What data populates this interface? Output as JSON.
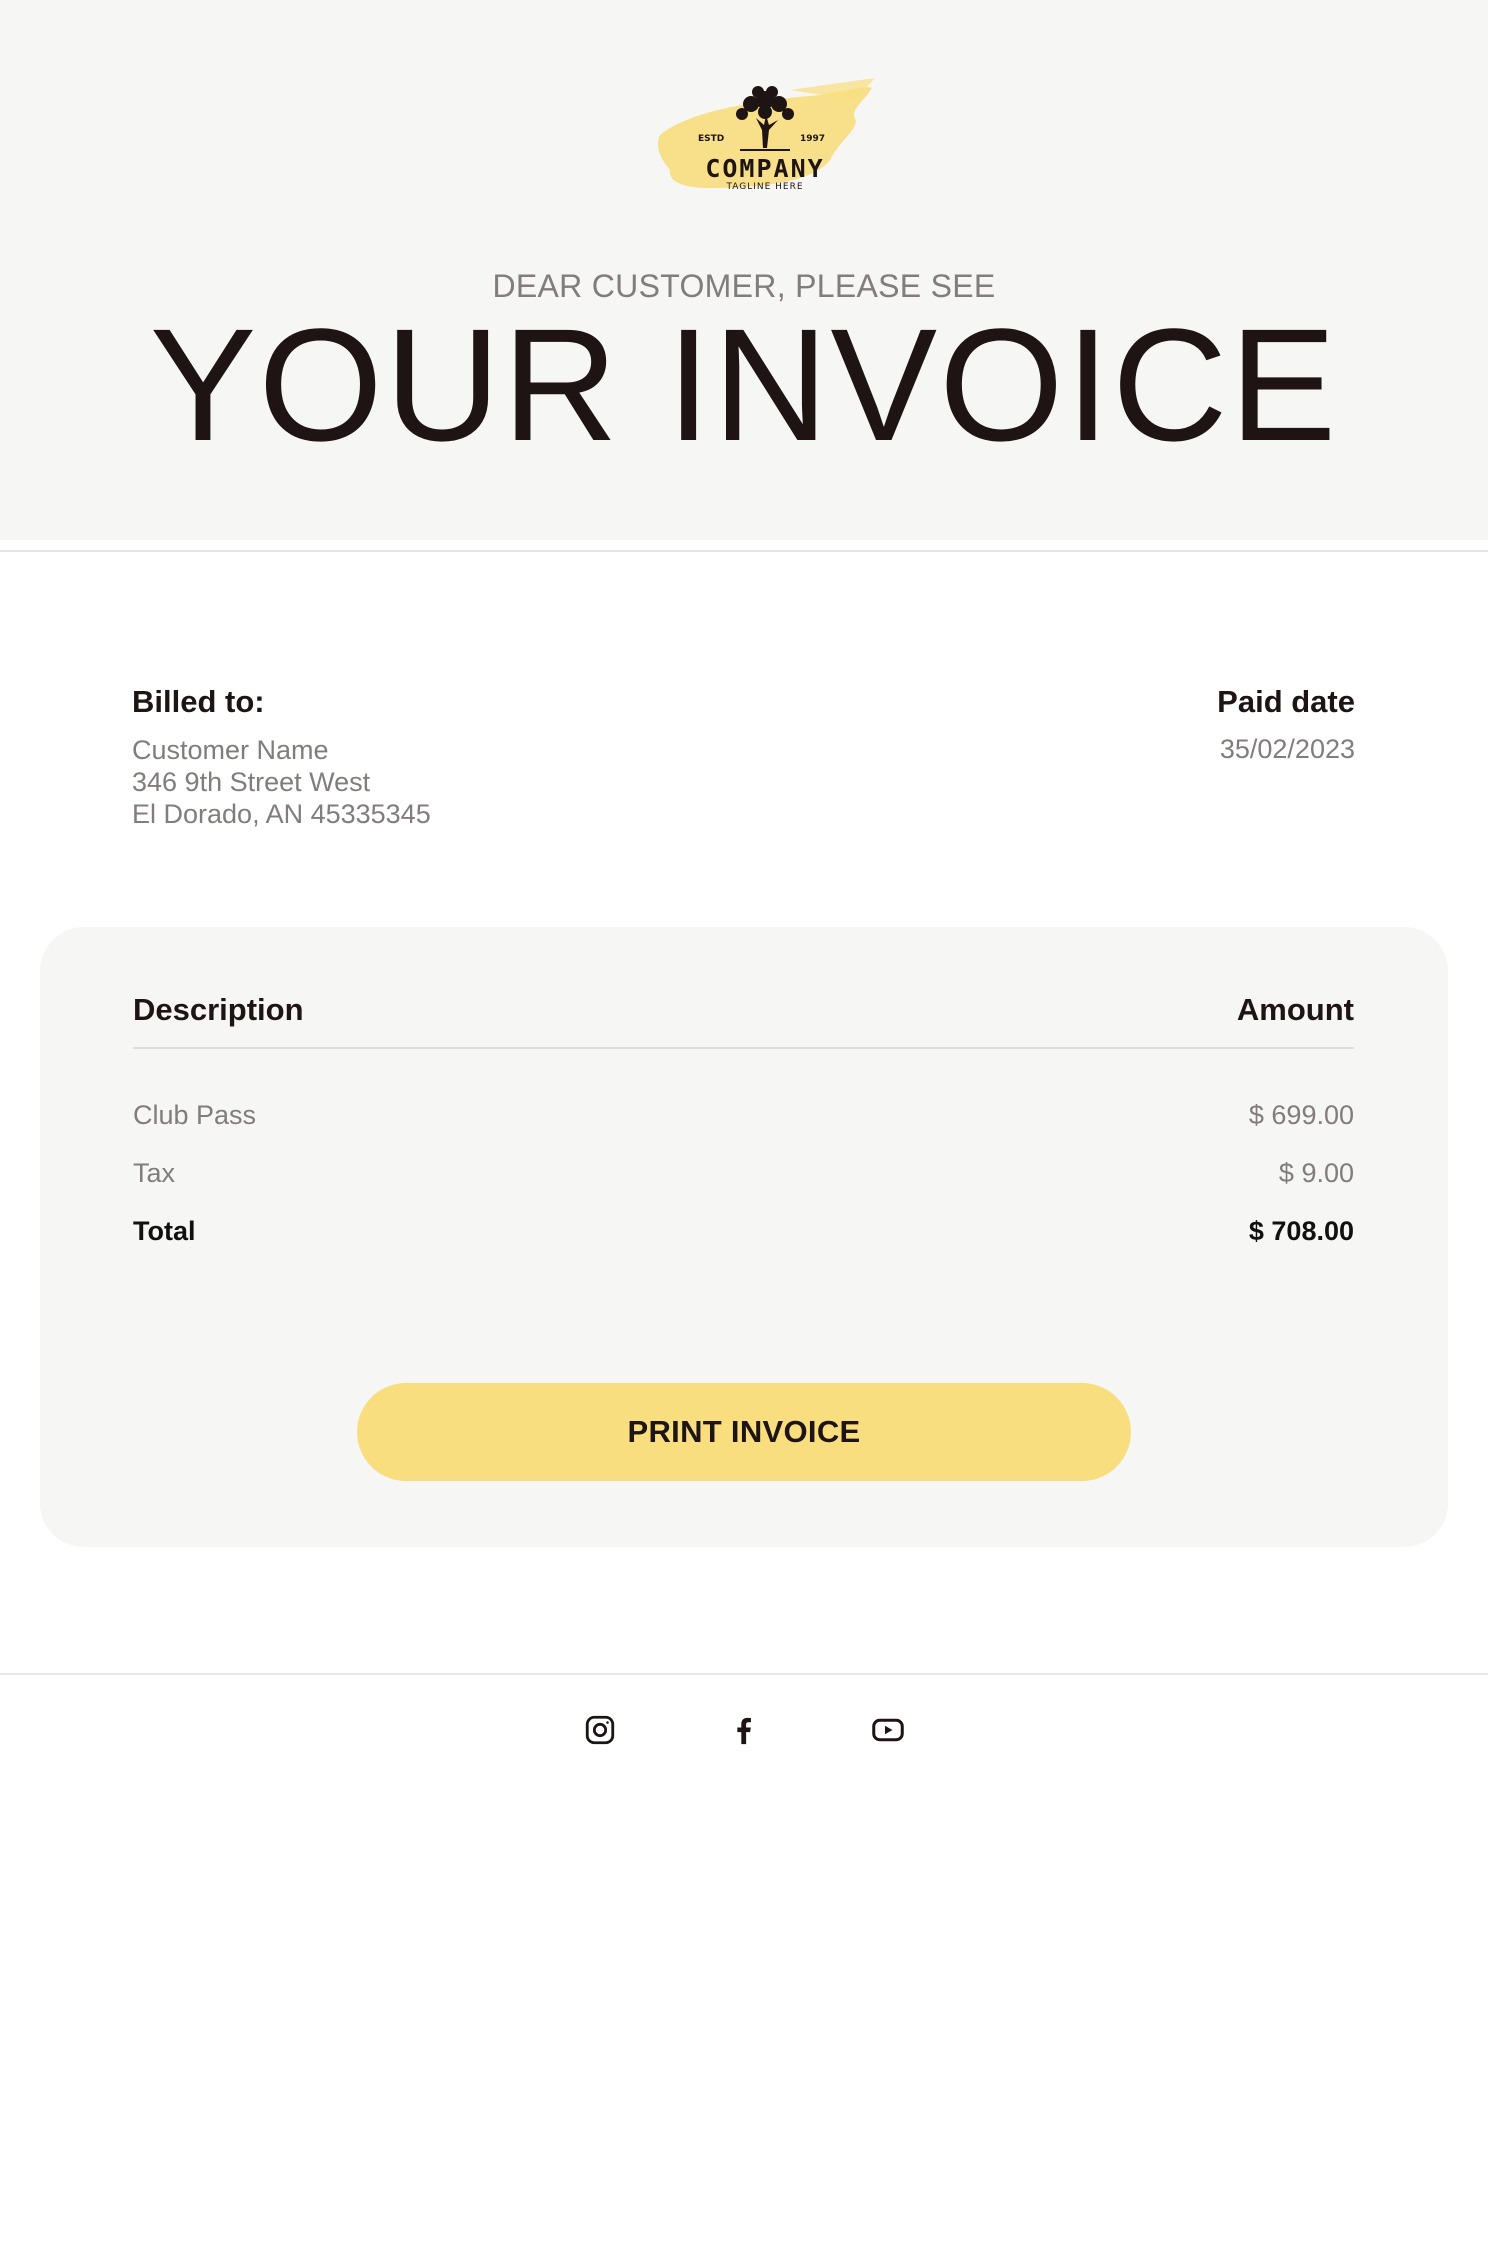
{
  "header": {
    "logo": {
      "name": "COMPANY",
      "tagline": "TAGLINE HERE",
      "estd": "ESTD",
      "year": "1997"
    },
    "greeting": "DEAR CUSTOMER, PLEASE SEE",
    "title": "YOUR INVOICE"
  },
  "billing": {
    "billed_label": "Billed to:",
    "customer_name": "Customer Name",
    "address_line1": "346 9th Street West",
    "address_line2": "El Dorado, AN 45335345",
    "paid_label": "Paid date",
    "paid_date": "35/02/2023"
  },
  "invoice": {
    "col_description": "Description",
    "col_amount": "Amount",
    "items": [
      {
        "label": "Club Pass",
        "amount": "$ 699.00"
      },
      {
        "label": "Tax",
        "amount": "$ 9.00"
      }
    ],
    "total": {
      "label": "Total",
      "amount": "$ 708.00"
    },
    "print_label": "PRINT INVOICE"
  },
  "social": [
    "instagram-icon",
    "facebook-icon",
    "youtube-icon"
  ],
  "colors": {
    "header_bg": "#f6f6f5",
    "accent": "#f8de7e",
    "text_dark": "#1e1414",
    "text_muted": "#827c7c"
  }
}
